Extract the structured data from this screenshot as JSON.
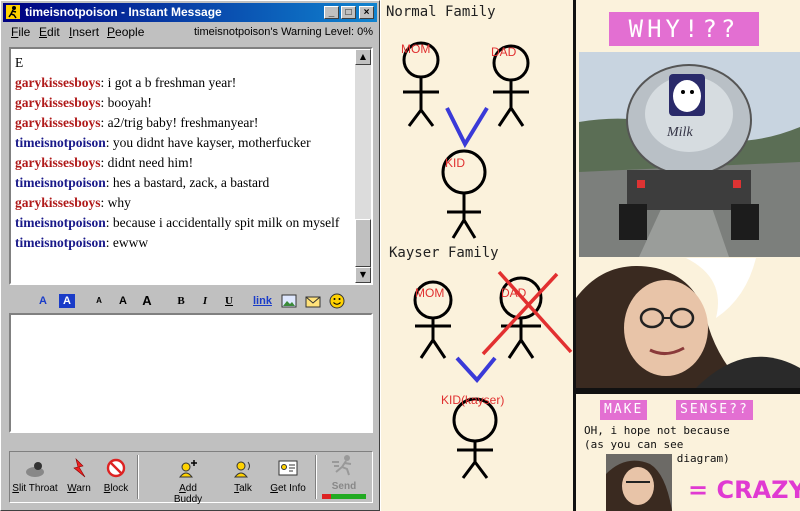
{
  "window": {
    "title": "timeisnotpoison - Instant Message",
    "menu": [
      {
        "label": "File",
        "u": "F",
        "rest": "ile"
      },
      {
        "label": "Edit",
        "u": "E",
        "rest": "dit"
      },
      {
        "label": "Insert",
        "u": "I",
        "rest": "nsert"
      },
      {
        "label": "People",
        "u": "P",
        "rest": "eople"
      }
    ],
    "warning": "timeisnotpoison's Warning Level: 0%"
  },
  "chat": {
    "first_line": "E",
    "messages": [
      {
        "who": "garykissesboys",
        "text": ": i got a b freshman year!"
      },
      {
        "who": "garykissesboys",
        "text": ": booyah!"
      },
      {
        "who": "garykissesboys",
        "text": ": a2/trig baby! freshmanyear!"
      },
      {
        "who": "timeisnotpoison",
        "text": ": you didnt have kayser, motherfucker"
      },
      {
        "who": "garykissesboys",
        "text": ": didnt need him!"
      },
      {
        "who": "timeisnotpoison",
        "text": ": hes a bastard, zack, a bastard"
      },
      {
        "who": "garykissesboys",
        "text": ": why"
      },
      {
        "who": "timeisnotpoison",
        "text": ": because i accidentally spit milk on myself"
      },
      {
        "who": "timeisnotpoison",
        "text": ": ewww"
      }
    ]
  },
  "format_bar": {
    "text_color": "A",
    "bg_color": "A",
    "smaller": "A",
    "normal": "A",
    "bigger": "A",
    "bold": "B",
    "italic": "I",
    "underline": "U",
    "link": "link"
  },
  "buttons": [
    {
      "key": "slit",
      "label_u": "S",
      "label_rest": "lit Throat"
    },
    {
      "key": "warn",
      "label_u": "W",
      "label_rest": "arn"
    },
    {
      "key": "block",
      "label_u": "B",
      "label_rest": "lock"
    },
    {
      "key": "addbuddy",
      "label_u": "A",
      "label_rest": "dd Buddy"
    },
    {
      "key": "talk",
      "label_u": "T",
      "label_rest": "alk"
    },
    {
      "key": "getinfo",
      "label_u": "G",
      "label_rest": "et Info"
    },
    {
      "key": "send",
      "label_u": "",
      "label_rest": "Send"
    }
  ],
  "comic": {
    "normal_heading": "Normal Family",
    "normal_mom": "MOM",
    "normal_dad": "DAD",
    "normal_kid": "KID",
    "kayser_heading": "Kayser Family",
    "kayser_mom": "MOM",
    "kayser_dad": "DAD",
    "kayser_kid": "KID(kayser)"
  },
  "right": {
    "why": "WHY!??",
    "make": "MAKE",
    "sense": "SENSE??",
    "note1": "OH, i hope not because",
    "note2": "(as you can see",
    "note3": "      by this diagram)",
    "crazy": "= CRAZY",
    "truck_word": "Milk"
  },
  "colors": {
    "red_name": "#b01a1a",
    "blue_name": "#1a1a8a",
    "pink": "#e36fd2",
    "cream": "#fbf2dc",
    "title_bar": "#000080"
  }
}
